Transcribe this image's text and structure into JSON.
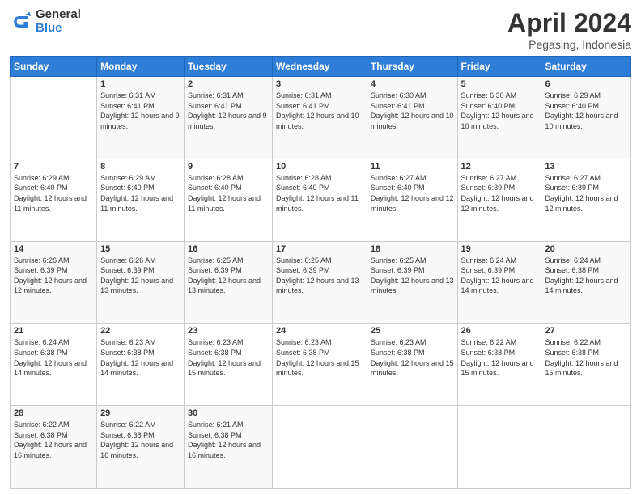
{
  "header": {
    "logo_general": "General",
    "logo_blue": "Blue",
    "title": "April 2024",
    "location": "Pegasing, Indonesia"
  },
  "weekdays": [
    "Sunday",
    "Monday",
    "Tuesday",
    "Wednesday",
    "Thursday",
    "Friday",
    "Saturday"
  ],
  "weeks": [
    [
      {
        "day": "",
        "sunrise": "",
        "sunset": "",
        "daylight": ""
      },
      {
        "day": "1",
        "sunrise": "Sunrise: 6:31 AM",
        "sunset": "Sunset: 6:41 PM",
        "daylight": "Daylight: 12 hours and 9 minutes."
      },
      {
        "day": "2",
        "sunrise": "Sunrise: 6:31 AM",
        "sunset": "Sunset: 6:41 PM",
        "daylight": "Daylight: 12 hours and 9 minutes."
      },
      {
        "day": "3",
        "sunrise": "Sunrise: 6:31 AM",
        "sunset": "Sunset: 6:41 PM",
        "daylight": "Daylight: 12 hours and 10 minutes."
      },
      {
        "day": "4",
        "sunrise": "Sunrise: 6:30 AM",
        "sunset": "Sunset: 6:41 PM",
        "daylight": "Daylight: 12 hours and 10 minutes."
      },
      {
        "day": "5",
        "sunrise": "Sunrise: 6:30 AM",
        "sunset": "Sunset: 6:40 PM",
        "daylight": "Daylight: 12 hours and 10 minutes."
      },
      {
        "day": "6",
        "sunrise": "Sunrise: 6:29 AM",
        "sunset": "Sunset: 6:40 PM",
        "daylight": "Daylight: 12 hours and 10 minutes."
      }
    ],
    [
      {
        "day": "7",
        "sunrise": "Sunrise: 6:29 AM",
        "sunset": "Sunset: 6:40 PM",
        "daylight": "Daylight: 12 hours and 11 minutes."
      },
      {
        "day": "8",
        "sunrise": "Sunrise: 6:29 AM",
        "sunset": "Sunset: 6:40 PM",
        "daylight": "Daylight: 12 hours and 11 minutes."
      },
      {
        "day": "9",
        "sunrise": "Sunrise: 6:28 AM",
        "sunset": "Sunset: 6:40 PM",
        "daylight": "Daylight: 12 hours and 11 minutes."
      },
      {
        "day": "10",
        "sunrise": "Sunrise: 6:28 AM",
        "sunset": "Sunset: 6:40 PM",
        "daylight": "Daylight: 12 hours and 11 minutes."
      },
      {
        "day": "11",
        "sunrise": "Sunrise: 6:27 AM",
        "sunset": "Sunset: 6:40 PM",
        "daylight": "Daylight: 12 hours and 12 minutes."
      },
      {
        "day": "12",
        "sunrise": "Sunrise: 6:27 AM",
        "sunset": "Sunset: 6:39 PM",
        "daylight": "Daylight: 12 hours and 12 minutes."
      },
      {
        "day": "13",
        "sunrise": "Sunrise: 6:27 AM",
        "sunset": "Sunset: 6:39 PM",
        "daylight": "Daylight: 12 hours and 12 minutes."
      }
    ],
    [
      {
        "day": "14",
        "sunrise": "Sunrise: 6:26 AM",
        "sunset": "Sunset: 6:39 PM",
        "daylight": "Daylight: 12 hours and 12 minutes."
      },
      {
        "day": "15",
        "sunrise": "Sunrise: 6:26 AM",
        "sunset": "Sunset: 6:39 PM",
        "daylight": "Daylight: 12 hours and 13 minutes."
      },
      {
        "day": "16",
        "sunrise": "Sunrise: 6:25 AM",
        "sunset": "Sunset: 6:39 PM",
        "daylight": "Daylight: 12 hours and 13 minutes."
      },
      {
        "day": "17",
        "sunrise": "Sunrise: 6:25 AM",
        "sunset": "Sunset: 6:39 PM",
        "daylight": "Daylight: 12 hours and 13 minutes."
      },
      {
        "day": "18",
        "sunrise": "Sunrise: 6:25 AM",
        "sunset": "Sunset: 6:39 PM",
        "daylight": "Daylight: 12 hours and 13 minutes."
      },
      {
        "day": "19",
        "sunrise": "Sunrise: 6:24 AM",
        "sunset": "Sunset: 6:39 PM",
        "daylight": "Daylight: 12 hours and 14 minutes."
      },
      {
        "day": "20",
        "sunrise": "Sunrise: 6:24 AM",
        "sunset": "Sunset: 6:38 PM",
        "daylight": "Daylight: 12 hours and 14 minutes."
      }
    ],
    [
      {
        "day": "21",
        "sunrise": "Sunrise: 6:24 AM",
        "sunset": "Sunset: 6:38 PM",
        "daylight": "Daylight: 12 hours and 14 minutes."
      },
      {
        "day": "22",
        "sunrise": "Sunrise: 6:23 AM",
        "sunset": "Sunset: 6:38 PM",
        "daylight": "Daylight: 12 hours and 14 minutes."
      },
      {
        "day": "23",
        "sunrise": "Sunrise: 6:23 AM",
        "sunset": "Sunset: 6:38 PM",
        "daylight": "Daylight: 12 hours and 15 minutes."
      },
      {
        "day": "24",
        "sunrise": "Sunrise: 6:23 AM",
        "sunset": "Sunset: 6:38 PM",
        "daylight": "Daylight: 12 hours and 15 minutes."
      },
      {
        "day": "25",
        "sunrise": "Sunrise: 6:23 AM",
        "sunset": "Sunset: 6:38 PM",
        "daylight": "Daylight: 12 hours and 15 minutes."
      },
      {
        "day": "26",
        "sunrise": "Sunrise: 6:22 AM",
        "sunset": "Sunset: 6:38 PM",
        "daylight": "Daylight: 12 hours and 15 minutes."
      },
      {
        "day": "27",
        "sunrise": "Sunrise: 6:22 AM",
        "sunset": "Sunset: 6:38 PM",
        "daylight": "Daylight: 12 hours and 15 minutes."
      }
    ],
    [
      {
        "day": "28",
        "sunrise": "Sunrise: 6:22 AM",
        "sunset": "Sunset: 6:38 PM",
        "daylight": "Daylight: 12 hours and 16 minutes."
      },
      {
        "day": "29",
        "sunrise": "Sunrise: 6:22 AM",
        "sunset": "Sunset: 6:38 PM",
        "daylight": "Daylight: 12 hours and 16 minutes."
      },
      {
        "day": "30",
        "sunrise": "Sunrise: 6:21 AM",
        "sunset": "Sunset: 6:38 PM",
        "daylight": "Daylight: 12 hours and 16 minutes."
      },
      {
        "day": "",
        "sunrise": "",
        "sunset": "",
        "daylight": ""
      },
      {
        "day": "",
        "sunrise": "",
        "sunset": "",
        "daylight": ""
      },
      {
        "day": "",
        "sunrise": "",
        "sunset": "",
        "daylight": ""
      },
      {
        "day": "",
        "sunrise": "",
        "sunset": "",
        "daylight": ""
      }
    ]
  ]
}
